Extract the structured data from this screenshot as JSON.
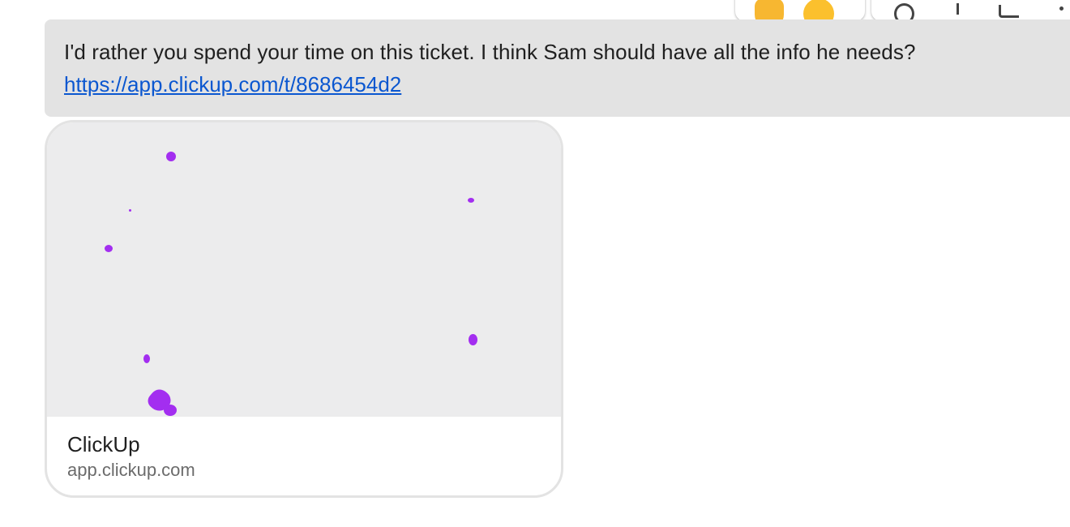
{
  "message": {
    "text": "I'd rather you spend your time on this ticket. I think Sam should have all the info he needs?",
    "link": "https://app.clickup.com/t/8686454d2"
  },
  "link_preview": {
    "title": "ClickUp",
    "domain": "app.clickup.com"
  },
  "hover_toolbar": {
    "reactions": [
      "thumbs-up-emoji",
      "smile-emoji"
    ],
    "actions": [
      "add-reaction-icon",
      "pin-icon",
      "reply-in-thread-icon",
      "more-options-icon"
    ]
  },
  "colors": {
    "bubble_bg": "#e3e3e3",
    "link": "#0b57d0",
    "preview_bg": "#ececed",
    "splat": "#a32ef0"
  }
}
